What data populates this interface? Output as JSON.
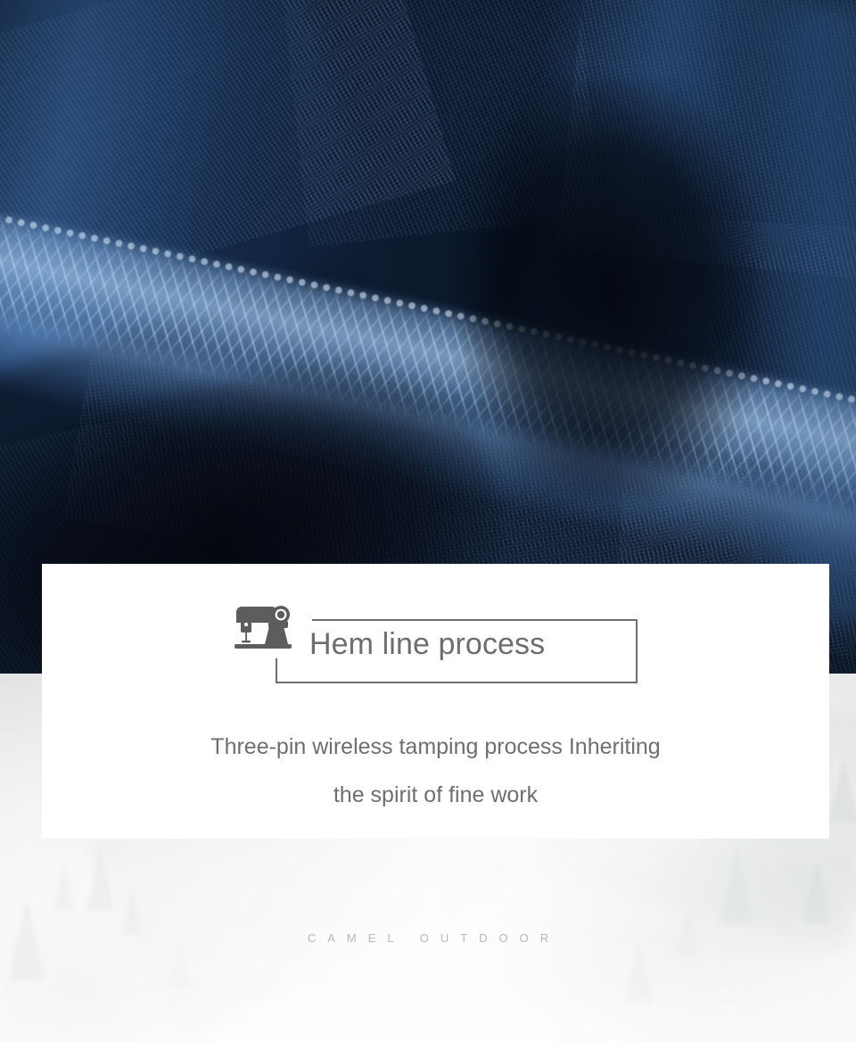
{
  "banner": {
    "image_alt": "navy knit fabric hem with overlock stitching close-up",
    "colors": {
      "fabric_dark": "#050b16",
      "fabric_mid": "#132746",
      "stitch_highlight": "#8cb2dc"
    }
  },
  "card": {
    "title": "Hem line process",
    "icon": "sewing-machine-icon",
    "subtitle_line1": "Three-pin wireless tamping process Inheriting",
    "subtitle_line2": "the spirit of fine work",
    "colors": {
      "background": "#ffffff",
      "text": "#6f6f6f",
      "frame": "#6e6e6e"
    }
  },
  "footer": {
    "watermark": "CAMEL OUTDOOR",
    "background_alt": "misty forest with evergreen trees",
    "colors": {
      "mist": "#f2f2f2",
      "watermark_text": "#a8aeac"
    }
  }
}
